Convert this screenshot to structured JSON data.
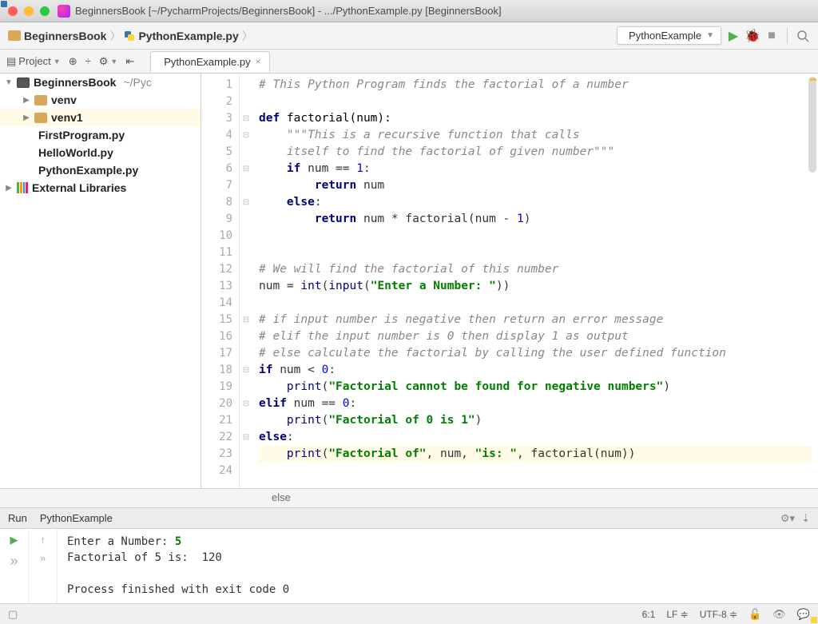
{
  "window": {
    "title": "BeginnersBook [~/PycharmProjects/BeginnersBook] - .../PythonExample.py [BeginnersBook]"
  },
  "breadcrumb": {
    "project": "BeginnersBook",
    "file": "PythonExample.py"
  },
  "run_config": {
    "label": "PythonExample"
  },
  "project_tool": {
    "label": "Project"
  },
  "editor_tab": {
    "label": "PythonExample.py"
  },
  "sidebar": {
    "items": [
      {
        "label": "BeginnersBook",
        "sublabel": "~/Pyc",
        "type": "project",
        "level": 0,
        "arrow": "down"
      },
      {
        "label": "venv",
        "type": "folder",
        "level": 1,
        "arrow": "right"
      },
      {
        "label": "venv1",
        "type": "folder",
        "level": 1,
        "arrow": "right",
        "selected": true
      },
      {
        "label": "FirstProgram.py",
        "type": "py",
        "level": 1
      },
      {
        "label": "HelloWorld.py",
        "type": "py",
        "level": 1
      },
      {
        "label": "PythonExample.py",
        "type": "py",
        "level": 1
      },
      {
        "label": "External Libraries",
        "type": "libs",
        "level": 0,
        "arrow": "right"
      }
    ]
  },
  "code": {
    "lines": [
      {
        "n": 1,
        "seg": [
          {
            "t": "# This Python Program finds the factorial of a number",
            "c": "c-comment"
          }
        ]
      },
      {
        "n": 2,
        "seg": []
      },
      {
        "n": 3,
        "seg": [
          {
            "t": "def ",
            "c": "c-kw"
          },
          {
            "t": "factorial(num):",
            "c": "c-def"
          }
        ]
      },
      {
        "n": 4,
        "seg": [
          {
            "t": "    ",
            "c": ""
          },
          {
            "t": "\"\"\"This is a recursive function that calls",
            "c": "c-docstr"
          }
        ]
      },
      {
        "n": 5,
        "seg": [
          {
            "t": "    itself to find the factorial of given number\"\"\"",
            "c": "c-docstr"
          }
        ]
      },
      {
        "n": 6,
        "seg": [
          {
            "t": "    ",
            "c": ""
          },
          {
            "t": "if",
            "c": "c-kw"
          },
          {
            "t": " num == ",
            "c": ""
          },
          {
            "t": "1",
            "c": "c-num"
          },
          {
            "t": ":",
            "c": ""
          }
        ]
      },
      {
        "n": 7,
        "seg": [
          {
            "t": "        ",
            "c": ""
          },
          {
            "t": "return",
            "c": "c-kw"
          },
          {
            "t": " num",
            "c": ""
          }
        ]
      },
      {
        "n": 8,
        "seg": [
          {
            "t": "    ",
            "c": ""
          },
          {
            "t": "else",
            "c": "c-kw"
          },
          {
            "t": ":",
            "c": ""
          }
        ]
      },
      {
        "n": 9,
        "seg": [
          {
            "t": "        ",
            "c": ""
          },
          {
            "t": "return",
            "c": "c-kw"
          },
          {
            "t": " num * factorial(num - ",
            "c": ""
          },
          {
            "t": "1",
            "c": "c-num"
          },
          {
            "t": ")",
            "c": ""
          }
        ]
      },
      {
        "n": 10,
        "seg": []
      },
      {
        "n": 11,
        "seg": []
      },
      {
        "n": 12,
        "seg": [
          {
            "t": "# We will find the factorial of this number",
            "c": "c-comment"
          }
        ]
      },
      {
        "n": 13,
        "seg": [
          {
            "t": "num = ",
            "c": ""
          },
          {
            "t": "int",
            "c": "c-builtin"
          },
          {
            "t": "(",
            "c": ""
          },
          {
            "t": "input",
            "c": "c-builtin"
          },
          {
            "t": "(",
            "c": ""
          },
          {
            "t": "\"Enter a Number: \"",
            "c": "c-str"
          },
          {
            "t": "))",
            "c": ""
          }
        ]
      },
      {
        "n": 14,
        "seg": []
      },
      {
        "n": 15,
        "seg": [
          {
            "t": "# if input number is negative then return an error message",
            "c": "c-comment"
          }
        ]
      },
      {
        "n": 16,
        "seg": [
          {
            "t": "# elif the input number is 0 then display 1 as output",
            "c": "c-comment"
          }
        ]
      },
      {
        "n": 17,
        "seg": [
          {
            "t": "# else calculate the factorial by calling the user defined function",
            "c": "c-comment"
          }
        ]
      },
      {
        "n": 18,
        "seg": [
          {
            "t": "if",
            "c": "c-kw"
          },
          {
            "t": " num < ",
            "c": ""
          },
          {
            "t": "0",
            "c": "c-num"
          },
          {
            "t": ":",
            "c": ""
          }
        ]
      },
      {
        "n": 19,
        "seg": [
          {
            "t": "    ",
            "c": ""
          },
          {
            "t": "print",
            "c": "c-builtin"
          },
          {
            "t": "(",
            "c": ""
          },
          {
            "t": "\"Factorial cannot be found for negative numbers\"",
            "c": "c-str"
          },
          {
            "t": ")",
            "c": ""
          }
        ]
      },
      {
        "n": 20,
        "seg": [
          {
            "t": "elif",
            "c": "c-kw"
          },
          {
            "t": " num == ",
            "c": ""
          },
          {
            "t": "0",
            "c": "c-num"
          },
          {
            "t": ":",
            "c": ""
          }
        ]
      },
      {
        "n": 21,
        "seg": [
          {
            "t": "    ",
            "c": ""
          },
          {
            "t": "print",
            "c": "c-builtin"
          },
          {
            "t": "(",
            "c": ""
          },
          {
            "t": "\"Factorial of 0 is 1\"",
            "c": "c-str"
          },
          {
            "t": ")",
            "c": ""
          }
        ]
      },
      {
        "n": 22,
        "seg": [
          {
            "t": "else",
            "c": "c-kw"
          },
          {
            "t": ":",
            "c": ""
          }
        ]
      },
      {
        "n": 23,
        "hl": true,
        "seg": [
          {
            "t": "    ",
            "c": ""
          },
          {
            "t": "print",
            "c": "c-builtin"
          },
          {
            "t": "(",
            "c": ""
          },
          {
            "t": "\"Factorial of\"",
            "c": "c-str"
          },
          {
            "t": ", num, ",
            "c": ""
          },
          {
            "t": "\"is: \"",
            "c": "c-str"
          },
          {
            "t": ", factorial(num))",
            "c": ""
          }
        ]
      },
      {
        "n": 24,
        "seg": []
      }
    ],
    "crumb": "else"
  },
  "run": {
    "tab_label": "Run",
    "config_label": "PythonExample",
    "console": {
      "prompt": "Enter a Number: ",
      "input": "5",
      "output_line": "Factorial of 5 is:  120",
      "exit_line": "Process finished with exit code 0"
    }
  },
  "statusbar": {
    "position": "6:1",
    "line_sep": "LF",
    "encoding": "UTF-8"
  }
}
